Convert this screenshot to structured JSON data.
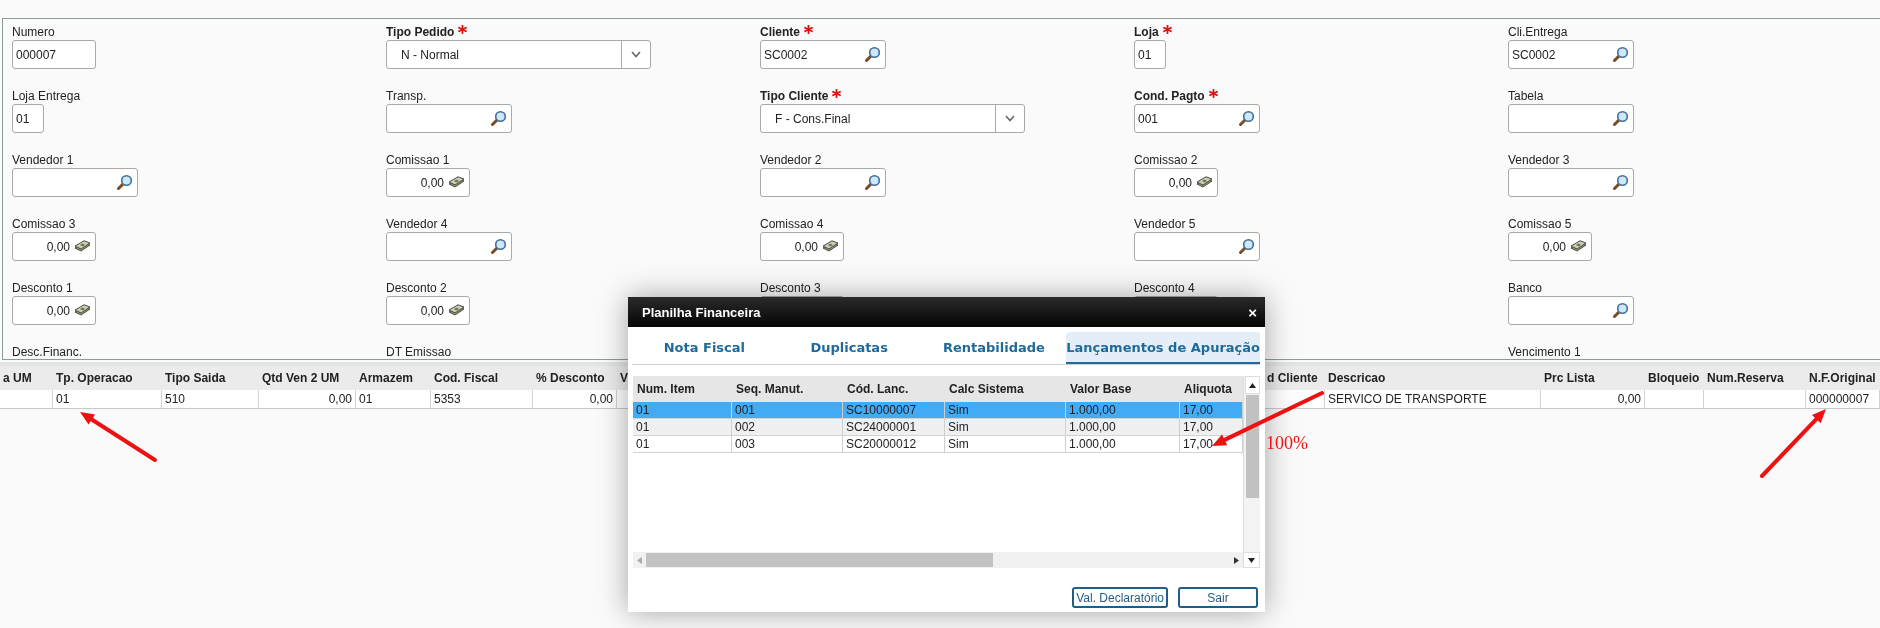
{
  "form": {
    "rows": [
      [
        {
          "label": "Numero",
          "required": false,
          "kind": "code",
          "value": "000007"
        },
        {
          "label": "Tipo Pedido",
          "required": true,
          "kind": "select",
          "value": "N - Normal"
        },
        {
          "label": "Cliente",
          "required": true,
          "kind": "lookup",
          "value": "SC0002"
        },
        {
          "label": "Loja",
          "required": true,
          "kind": "tiny",
          "value": "01"
        },
        {
          "label": "Cli.Entrega",
          "required": false,
          "kind": "lookup",
          "value": "SC0002"
        }
      ],
      [
        {
          "label": "Loja Entrega",
          "required": false,
          "kind": "tiny",
          "value": "01"
        },
        {
          "label": "Transp.",
          "required": false,
          "kind": "lookup"
        },
        {
          "label": "Tipo Cliente",
          "required": true,
          "kind": "select",
          "value": "F - Cons.Final"
        },
        {
          "label": "Cond. Pagto",
          "required": true,
          "kind": "lookup",
          "value": "001"
        },
        {
          "label": "Tabela",
          "required": false,
          "kind": "lookup"
        }
      ],
      [
        {
          "label": "Vendedor 1",
          "required": false,
          "kind": "lookup"
        },
        {
          "label": "Comissao 1",
          "required": false,
          "kind": "money",
          "value": "0,00"
        },
        {
          "label": "Vendedor 2",
          "required": false,
          "kind": "lookup"
        },
        {
          "label": "Comissao 2",
          "required": false,
          "kind": "money",
          "value": "0,00"
        },
        {
          "label": "Vendedor 3",
          "required": false,
          "kind": "lookup"
        }
      ],
      [
        {
          "label": "Comissao 3",
          "required": false,
          "kind": "money",
          "value": "0,00"
        },
        {
          "label": "Vendedor 4",
          "required": false,
          "kind": "lookup"
        },
        {
          "label": "Comissao 4",
          "required": false,
          "kind": "money",
          "value": "0,00"
        },
        {
          "label": "Vendedor 5",
          "required": false,
          "kind": "lookup"
        },
        {
          "label": "Comissao 5",
          "required": false,
          "kind": "money",
          "value": "0,00"
        }
      ],
      [
        {
          "label": "Desconto 1",
          "required": false,
          "kind": "money",
          "value": "0,00"
        },
        {
          "label": "Desconto 2",
          "required": false,
          "kind": "money",
          "value": "0,00"
        },
        {
          "label": "Desconto 3",
          "required": false,
          "kind": "covered"
        },
        {
          "label": "Desconto 4",
          "required": false,
          "kind": "covered"
        },
        {
          "label": "Banco",
          "required": false,
          "kind": "lookup"
        }
      ],
      [
        {
          "label": "Desc.Financ.",
          "required": false,
          "kind": "cut"
        },
        {
          "label": "DT Emissao",
          "required": false,
          "kind": "cut"
        },
        "",
        "",
        {
          "label": "Vencimento 1",
          "required": false,
          "kind": "cut"
        }
      ]
    ]
  },
  "items_grid": {
    "left_columns": [
      "a UM",
      "Tp. Operacao",
      "Tipo Saida",
      "Qtd Ven 2 UM",
      "Armazem",
      "Cod. Fiscal",
      "% Desconto",
      "V"
    ],
    "right_columns": [
      "d Cliente",
      "Descricao",
      "Prc Lista",
      "Bloqueio",
      "Num.Reserva",
      "N.F.Original"
    ],
    "left_cells": [
      {
        "kind": "empty"
      },
      {
        "kind": "text",
        "text": "01"
      },
      {
        "kind": "text",
        "text": "510"
      },
      {
        "kind": "number",
        "text": "0,00"
      },
      {
        "kind": "text",
        "text": "01"
      },
      {
        "kind": "text",
        "text": "5353"
      },
      {
        "kind": "number",
        "text": "0,00"
      },
      {
        "kind": "empty"
      }
    ],
    "right_cells": [
      {
        "kind": "empty"
      },
      {
        "kind": "text",
        "text": "SERVICO DE TRANSPORTE"
      },
      {
        "kind": "number",
        "text": "0,00"
      },
      {
        "kind": "empty"
      },
      {
        "kind": "empty"
      },
      {
        "kind": "text",
        "text": "000000007"
      }
    ]
  },
  "dialog": {
    "title": "Planilha Financeira",
    "close": "×",
    "tabs": [
      {
        "label": "Nota Fiscal",
        "selected": false
      },
      {
        "label": "Duplicatas",
        "selected": false
      },
      {
        "label": "Rentabilidade",
        "selected": false
      },
      {
        "label": "Lançamentos de Apuração",
        "selected": true
      }
    ],
    "columns": [
      "Num. Item",
      "Seq. Manut.",
      "Cód. Lanc.",
      "Calc Sistema",
      "Valor Base",
      "Aliquota"
    ],
    "rows": [
      {
        "cells": [
          "01",
          "001",
          "SC10000007",
          "Sim",
          "1.000,00",
          "17,00"
        ],
        "selected": true
      },
      {
        "cells": [
          "01",
          "002",
          "SC24000001",
          "Sim",
          "1.000,00",
          "17,00"
        ],
        "selected": false
      },
      {
        "cells": [
          "01",
          "003",
          "SC20000012",
          "Sim",
          "1.000,00",
          "17,00"
        ],
        "selected": false
      }
    ],
    "buttons": [
      "Val. Declaratório",
      "Sair"
    ]
  },
  "annotations": [
    {
      "kind": "arrow"
    },
    {
      "kind": "arrow"
    },
    {
      "kind": "arrow"
    },
    {
      "kind": "label",
      "text": "100%"
    }
  ]
}
